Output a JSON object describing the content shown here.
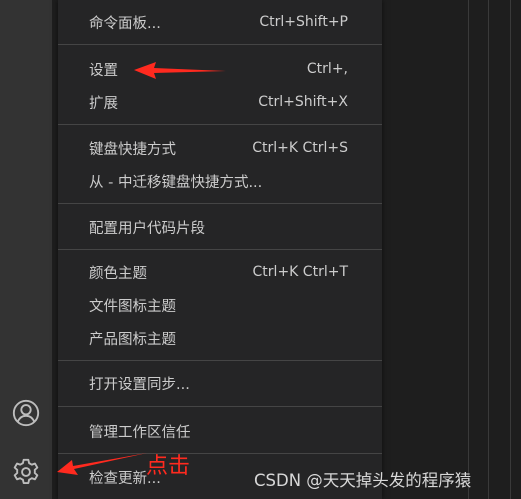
{
  "menu": {
    "items": [
      {
        "label": "命令面板...",
        "shortcut": "Ctrl+Shift+P"
      },
      {
        "label": "设置",
        "shortcut": "Ctrl+,"
      },
      {
        "label": "扩展",
        "shortcut": "Ctrl+Shift+X"
      },
      {
        "label": "键盘快捷方式",
        "shortcut": "Ctrl+K Ctrl+S"
      },
      {
        "label": "从 - 中迁移键盘快捷方式...",
        "shortcut": ""
      },
      {
        "label": "配置用户代码片段",
        "shortcut": ""
      },
      {
        "label": "颜色主题",
        "shortcut": "Ctrl+K Ctrl+T"
      },
      {
        "label": "文件图标主题",
        "shortcut": ""
      },
      {
        "label": "产品图标主题",
        "shortcut": ""
      },
      {
        "label": "打开设置同步...",
        "shortcut": ""
      },
      {
        "label": "管理工作区信任",
        "shortcut": ""
      },
      {
        "label": "检查更新...",
        "shortcut": ""
      }
    ]
  },
  "activity_bar": {
    "icons": [
      "account-icon",
      "gear-icon"
    ]
  },
  "annotation": {
    "text": "点击",
    "color": "#ff2a1f"
  },
  "watermark": "CSDN @天天掉头发的程序猿",
  "colors": {
    "menu_bg": "#252526",
    "menu_text": "#cccccc",
    "activity_bar_bg": "#333333",
    "editor_bg": "#1e1e1e",
    "annotation_red": "#ff2a1f"
  }
}
